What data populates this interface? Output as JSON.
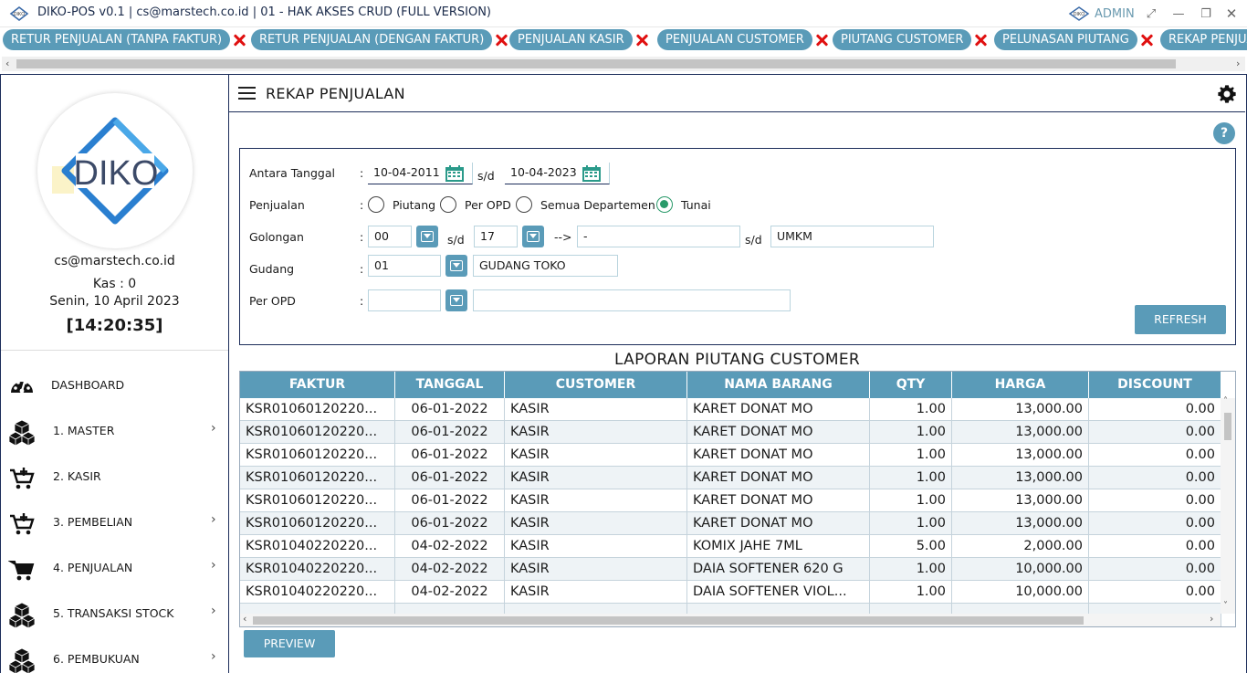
{
  "titlebar": {
    "title": "DIKO-POS v0.1 | cs@marstech.co.id | 01 - HAK AKSES CRUD (FULL VERSION)",
    "user": "ADMIN"
  },
  "tabs": [
    {
      "label": "RETUR PENJUALAN (TANPA FAKTUR)"
    },
    {
      "label": "RETUR PENJUALAN (DENGAN FAKTUR)"
    },
    {
      "label": "PENJUALAN KASIR"
    },
    {
      "label": "PENJUALAN CUSTOMER"
    },
    {
      "label": "PIUTANG CUSTOMER"
    },
    {
      "label": "PELUNASAN PIUTANG"
    },
    {
      "label": "REKAP PENJUALAN"
    }
  ],
  "sidebar": {
    "logo_text": "DIKO",
    "email": "cs@marstech.co.id",
    "kas": "Kas : 0",
    "date": "Senin, 10 April 2023",
    "time": "[14:20:35]",
    "items": [
      {
        "label": "DASHBOARD",
        "icon": "dashboard-icon",
        "has_children": false
      },
      {
        "label": "1. MASTER",
        "icon": "boxes-icon",
        "has_children": true
      },
      {
        "label": "2. KASIR",
        "icon": "cart-add-icon",
        "has_children": false
      },
      {
        "label": "3. PEMBELIAN",
        "icon": "cart-add-icon",
        "has_children": true
      },
      {
        "label": "4. PENJUALAN",
        "icon": "cart-icon",
        "has_children": true
      },
      {
        "label": "5. TRANSAKSI STOCK",
        "icon": "boxes-icon",
        "has_children": true
      },
      {
        "label": "6. PEMBUKUAN",
        "icon": "boxes-icon",
        "has_children": true
      }
    ]
  },
  "main": {
    "title": "REKAP PENJUALAN",
    "help": "?"
  },
  "filter": {
    "date_label": "Antara Tanggal",
    "date_from": "10-04-2011",
    "date_sep": "s/d",
    "date_to": "10-04-2023",
    "penjualan_label": "Penjualan",
    "penjualan_options": [
      "Piutang",
      "Per OPD",
      "Semua Departemen",
      "Tunai"
    ],
    "penjualan_selected": "Tunai",
    "golongan_label": "Golongan",
    "golongan_from": "00",
    "golongan_sep": "s/d",
    "golongan_to": "17",
    "golongan_arrow": "-->",
    "golongan_from_name": "-",
    "golongan_sep2": "s/d",
    "golongan_to_name": "UMKM",
    "gudang_label": "Gudang",
    "gudang_code": "01",
    "gudang_name": "GUDANG TOKO",
    "opd_label": "Per OPD",
    "opd_code": "",
    "opd_name": "",
    "colon": ":",
    "refresh_label": "REFRESH"
  },
  "report": {
    "title": "LAPORAN PIUTANG CUSTOMER",
    "columns": [
      "FAKTUR",
      "TANGGAL",
      "CUSTOMER",
      "NAMA BARANG",
      "QTY",
      "HARGA",
      "DISCOUNT"
    ],
    "rows": [
      [
        "KSR01060120220...",
        "06-01-2022",
        "KASIR",
        "KARET DONAT MO",
        "1.00",
        "13,000.00",
        "0.00"
      ],
      [
        "KSR01060120220...",
        "06-01-2022",
        "KASIR",
        "KARET DONAT MO",
        "1.00",
        "13,000.00",
        "0.00"
      ],
      [
        "KSR01060120220...",
        "06-01-2022",
        "KASIR",
        "KARET DONAT MO",
        "1.00",
        "13,000.00",
        "0.00"
      ],
      [
        "KSR01060120220...",
        "06-01-2022",
        "KASIR",
        "KARET DONAT MO",
        "1.00",
        "13,000.00",
        "0.00"
      ],
      [
        "KSR01060120220...",
        "06-01-2022",
        "KASIR",
        "KARET DONAT MO",
        "1.00",
        "13,000.00",
        "0.00"
      ],
      [
        "KSR01060120220...",
        "06-01-2022",
        "KASIR",
        "KARET DONAT MO",
        "1.00",
        "13,000.00",
        "0.00"
      ],
      [
        "KSR01040220220...",
        "04-02-2022",
        "KASIR",
        "KOMIX JAHE 7ML",
        "5.00",
        "2,000.00",
        "0.00"
      ],
      [
        "KSR01040220220...",
        "04-02-2022",
        "KASIR",
        "DAIA SOFTENER 620 G",
        "1.00",
        "10,000.00",
        "0.00"
      ],
      [
        "KSR01040220220...",
        "04-02-2022",
        "KASIR",
        "DAIA SOFTENER VIOL...",
        "1.00",
        "10,000.00",
        "0.00"
      ]
    ],
    "preview_label": "PREVIEW"
  },
  "colors": {
    "accent": "#5a9bb8",
    "border": "#1c2d5a",
    "close": "#e01010",
    "radio_on": "#2a9a6a"
  }
}
